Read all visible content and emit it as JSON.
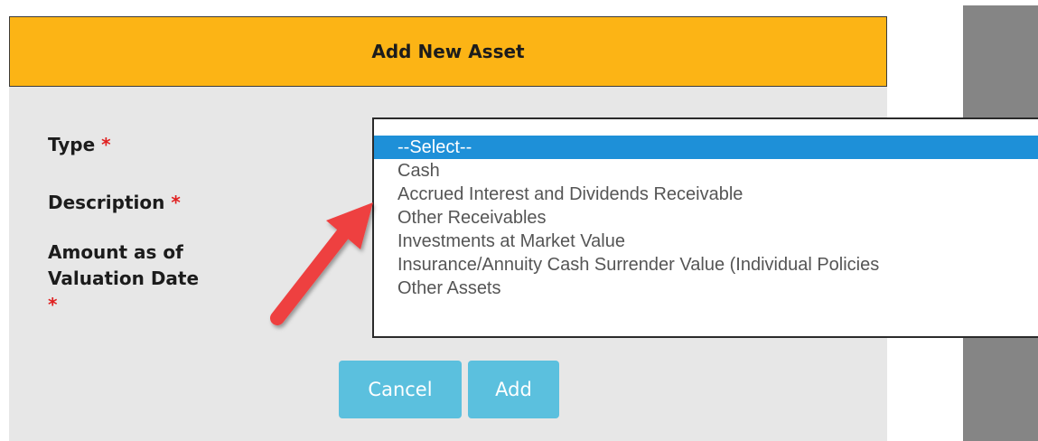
{
  "dialog": {
    "title": "Add New Asset",
    "header_color": "#fcb415"
  },
  "form": {
    "type_label": "Type",
    "description_label": "Description",
    "amount_label_line1": "Amount as of",
    "amount_label_line2": "Valuation Date",
    "required_marker": "*"
  },
  "type_select": {
    "options": [
      "--Select--",
      "Cash",
      "Accrued Interest and Dividends Receivable",
      "Other Receivables",
      "Investments at Market Value",
      "Insurance/Annuity Cash Surrender Value (Individual Policies",
      "Other Assets"
    ],
    "highlighted_option": "--Select--",
    "highlight_color": "#1e90d8"
  },
  "buttons": {
    "cancel_label": "Cancel",
    "add_label": "Add",
    "button_color": "#5bc0de"
  },
  "annotation": {
    "arrow_color": "#ee4040",
    "arrow_icon": "red-arrow-icon"
  }
}
